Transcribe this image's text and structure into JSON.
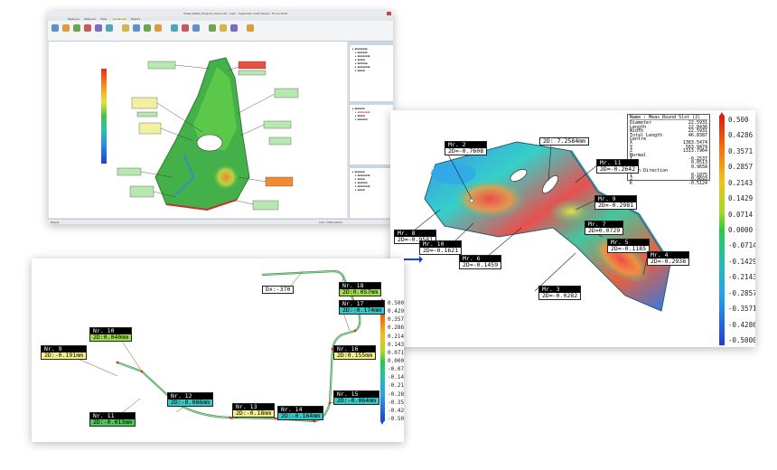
{
  "app": {
    "title": "Sheet_Metal_Program_demo.cbf - Cam - Inspection Gold Issued - Focus 2014",
    "tabs": [
      "Features",
      "Measure",
      "View",
      "Construct",
      "Report"
    ],
    "statusbar": {
      "left": "Ready",
      "right": "Inch / Millimeters"
    }
  },
  "deviation_panel": {
    "scale": [
      "0.500",
      "0.4286",
      "0.3571",
      "0.2857",
      "0.2143",
      "0.1429",
      "0.0714",
      "0.0000",
      "-0.0714",
      "-0.1429",
      "-0.2143",
      "-0.2857",
      "-0.3571",
      "-0.4286",
      "-0.5000"
    ],
    "info_box": {
      "title": "Name : Meas_Round Slot (2)",
      "rows": [
        {
          "k": "Diameter",
          "v": "22.5931"
        },
        {
          "k": "Length",
          "v": "22.8436"
        },
        {
          "k": "Width",
          "v": "22.5931"
        },
        {
          "k": "Total Length",
          "v": "46.8387"
        },
        {
          "k": "Centre",
          "v": ""
        },
        {
          "k": "X",
          "v": "1383.5474"
        },
        {
          "k": "Y",
          "v": "563.9474"
        },
        {
          "k": "Z",
          "v": "1313.7964"
        },
        {
          "k": "Normal",
          "v": ""
        },
        {
          "k": "I",
          "v": "-0.2537"
        },
        {
          "k": "J",
          "v": "0.0513"
        },
        {
          "k": "K",
          "v": "0.9658"
        },
        {
          "k": "Main Direction",
          "v": ""
        },
        {
          "k": "I",
          "v": "0.1875"
        },
        {
          "k": "J",
          "v": "0.9693"
        },
        {
          "k": "K",
          "v": "-0.5124"
        }
      ]
    },
    "tags": [
      {
        "hd": "Mr. 2",
        "vl": "2D=-0.7608"
      },
      {
        "hd": "",
        "vl": "2D: 7.2584mm"
      },
      {
        "hd": "Mr. 11",
        "vl": "2D=-0.2642"
      },
      {
        "hd": "Mr. 9",
        "vl": "2D=-0.2981"
      },
      {
        "hd": "Mr. 8",
        "vl": "2D=-0.9581"
      },
      {
        "hd": "Mr. 10",
        "vl": "2D=-0.1621"
      },
      {
        "hd": "Mr. 7",
        "vl": "2D=0.0729"
      },
      {
        "hd": "Mr. 6",
        "vl": "2D=-0.1459"
      },
      {
        "hd": "Mr. 5",
        "vl": "2D=-0.1185"
      },
      {
        "hd": "Mr. 4",
        "vl": "2D=-0.2938"
      },
      {
        "hd": "Mr. 3",
        "vl": "2D=-0.0282"
      }
    ]
  },
  "profile_panel": {
    "scale": [
      "0.500",
      "0.429",
      "0.357",
      "0.286",
      "0.214",
      "0.143",
      "0.071",
      "0.000",
      "-0.071",
      "-0.143",
      "-0.214",
      "-0.286",
      "-0.357",
      "-0.429",
      "-0.500"
    ],
    "tags": [
      {
        "hd": "Nr. 9",
        "vl": "2D:-0.191mm"
      },
      {
        "hd": "Nr. 10",
        "vl": "2D:0.040mm"
      },
      {
        "hd": "Nr. 11",
        "vl": "2D:-0.013mm"
      },
      {
        "hd": "Nr. 12",
        "vl": "2D:-0.086mm"
      },
      {
        "hd": "Nr. 13",
        "vl": "2D:-0.18mm"
      },
      {
        "hd": "Nr. 14",
        "vl": "2D:-0.164mm"
      },
      {
        "hd": "Nr. 15",
        "vl": "2D:-0.064mm"
      },
      {
        "hd": "Nr. 16",
        "vl": "2D:0.155mm"
      },
      {
        "hd": "Nr. 17",
        "vl": "2D:-0.174mm"
      },
      {
        "hd": "Nr. 18",
        "vl": "2D:0.057mm"
      },
      {
        "hd": "",
        "vl": "Dx:-370"
      }
    ]
  }
}
